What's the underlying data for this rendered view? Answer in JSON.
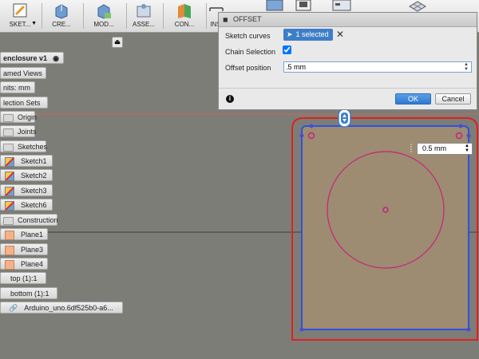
{
  "toolbar": {
    "sketch_label": "SKET...",
    "create_label": "CRE...",
    "modify_label": "MOD...",
    "assemble_label": "ASSE...",
    "construct_label": "CON...",
    "inspect_label": "INS"
  },
  "browser": {
    "root": "enclosure v1",
    "named_views": "amed Views",
    "units": "nits: mm",
    "selection_sets": "lection Sets",
    "origin": "Origin",
    "joints": "Joints",
    "sketches": "Sketches",
    "sketch_items": [
      "Sketch1",
      "Sketch2",
      "Sketch3",
      "Sketch6"
    ],
    "construction": "Construction",
    "plane_items": [
      "Plane1",
      "Plane3",
      "Plane4"
    ],
    "top": "top (1):1",
    "bottom": "bottom (1):1",
    "link": "Arduino_uno.6df525b0-a6..."
  },
  "dialog": {
    "title": "OFFSET",
    "sketch_curves_label": "Sketch curves",
    "selected_label": "1 selected",
    "chain_selection_label": "Chain Selection",
    "chain_selection_checked": true,
    "offset_position_label": "Offset position",
    "offset_position_value": ".5 mm",
    "ok_label": "OK",
    "cancel_label": "Cancel"
  },
  "canvas": {
    "offset_value": "0.5 mm"
  },
  "colors": {
    "selection_blue": "#3d7ec8",
    "profile_fill": "#9d8b72",
    "offset_red": "#e0201e",
    "sketch_blue": "#2f51e0",
    "circle_magenta": "#c4247a"
  }
}
